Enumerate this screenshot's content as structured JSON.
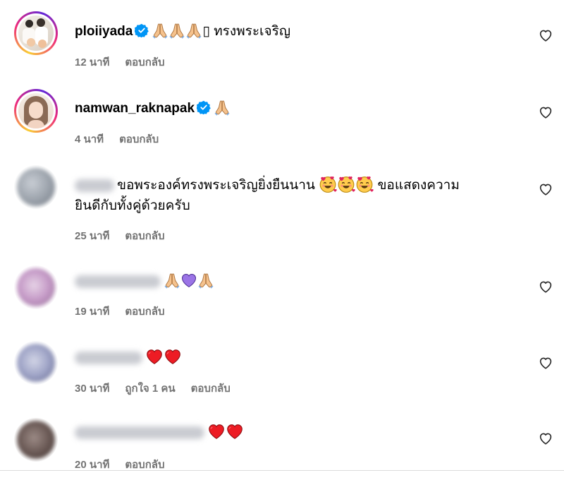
{
  "colors": {
    "secondary_text": "#737373",
    "verified_blue": "#0095f6",
    "heart_red": "#ed1c24"
  },
  "comments": [
    {
      "username": "ploiiyada",
      "verified": true,
      "emojis": [
        "folded-hands",
        "folded-hands",
        "folded-hands",
        "missing-glyph"
      ],
      "missing_glyph": "▯",
      "text": "ทรงพระเจริญ",
      "time": "12 นาที",
      "reply_label": "ตอบกลับ"
    },
    {
      "username": "namwan_raknapak",
      "verified": true,
      "emojis": [
        "folded-hands"
      ],
      "text": "",
      "time": "4 นาที",
      "reply_label": "ตอบกลับ"
    },
    {
      "username_blurred": true,
      "text_line1": "ขอพระองค์ทรงพระเจริญยิ่งยืนนาน",
      "text_line1_after": "ขอแสดงความ",
      "text_line2": "ยินดีกับทั้งคู่ด้วยครับ",
      "emojis": [
        "smiling-face-with-hearts",
        "smiling-face-with-hearts",
        "smiling-face-with-hearts"
      ],
      "time": "25 นาที",
      "reply_label": "ตอบกลับ"
    },
    {
      "username_blurred": true,
      "emojis": [
        "folded-hands",
        "purple-heart",
        "folded-hands"
      ],
      "time": "19 นาที",
      "reply_label": "ตอบกลับ"
    },
    {
      "username_blurred": true,
      "emojis": [
        "red-heart",
        "red-heart"
      ],
      "time": "30 นาที",
      "likes_label": "ถูกใจ 1 คน",
      "reply_label": "ตอบกลับ"
    },
    {
      "username_blurred": true,
      "emojis": [
        "red-heart",
        "red-heart"
      ],
      "time": "20 นาที",
      "reply_label": "ตอบกลับ"
    }
  ],
  "icons": {
    "like": "heart-outline-icon",
    "verified": "verified-badge-icon"
  }
}
